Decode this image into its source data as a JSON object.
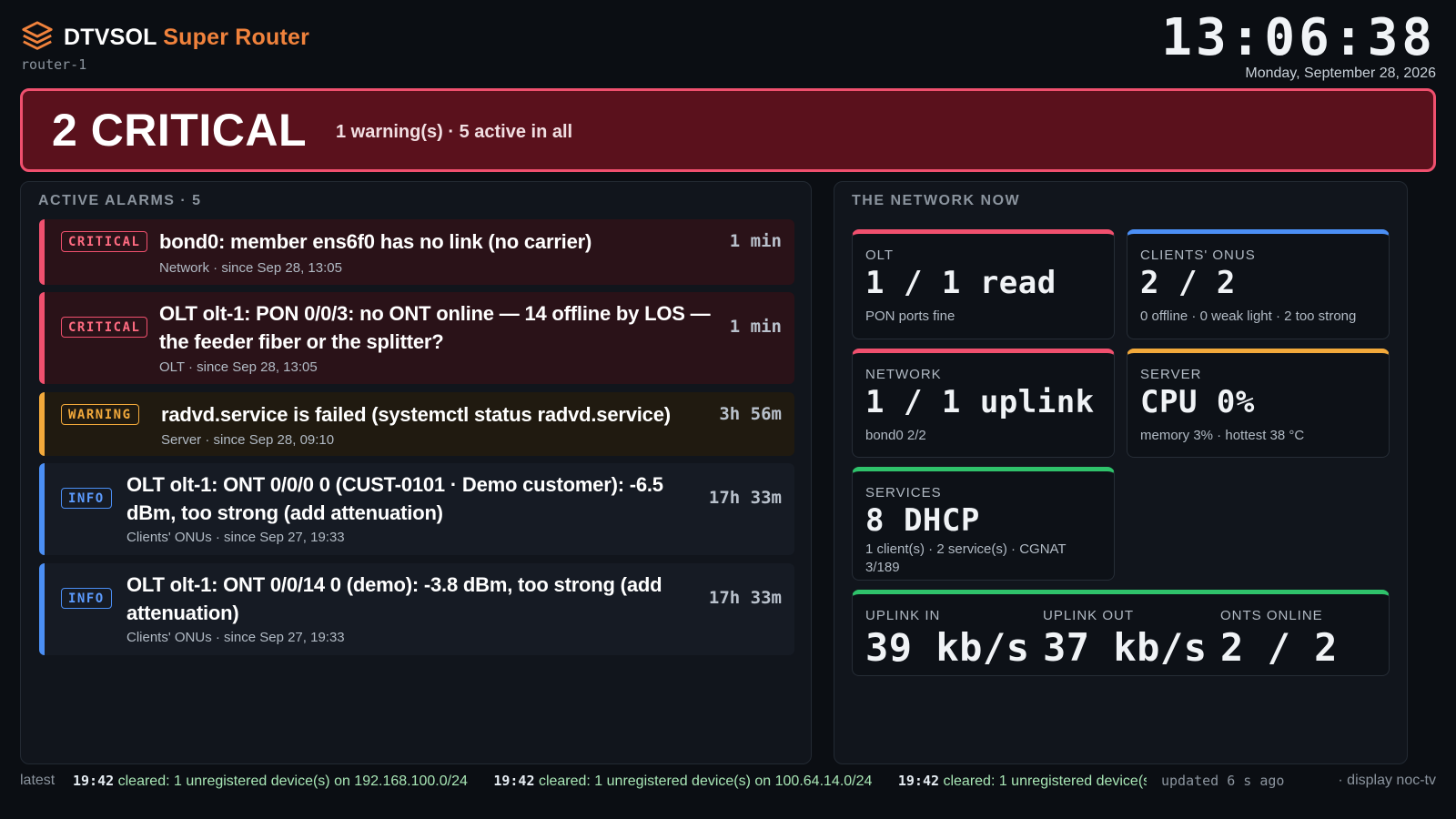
{
  "header": {
    "brand_main": "DTVSOL",
    "brand_accent": "Super Router",
    "hostname": "router-1",
    "clock": "13:06:38",
    "date": "Monday, September 28, 2026",
    "logo_icon": "layers-icon",
    "accent_color": "#f0823c"
  },
  "banner": {
    "headline": "2 CRITICAL",
    "summary": "1 warning(s) · 5 active in all",
    "color": "#f0506e"
  },
  "alarms_panel": {
    "title": "ACTIVE ALARMS · 5",
    "items": [
      {
        "severity": "CRITICAL",
        "title": "bond0: member ens6f0 has no link (no carrier)",
        "meta": "Network · since Sep 28, 13:05",
        "age": "1 min"
      },
      {
        "severity": "CRITICAL",
        "title_line1": "OLT olt-1: PON 0/0/3: no ONT online — 14 offline by LOS —",
        "title_line2": "the feeder fiber or the splitter?",
        "meta": "OLT · since Sep 28, 13:05",
        "age": "1 min"
      },
      {
        "severity": "WARNING",
        "title": "radvd.service is failed (systemctl status radvd.service)",
        "meta": "Server · since Sep 28, 09:10",
        "age": "3h 56m"
      },
      {
        "severity": "INFO",
        "title_line1": "OLT olt-1: ONT 0/0/0 0 (CUST-0101 · Demo customer): -6.5",
        "title_line2": "dBm, too strong (add attenuation)",
        "meta": "Clients' ONUs · since Sep 27, 19:33",
        "age": "17h 33m"
      },
      {
        "severity": "INFO",
        "title_line1": "OLT olt-1: ONT 0/0/14 0 (demo): -3.8 dBm, too strong (add",
        "title_line2": "attenuation)",
        "meta": "Clients' ONUs · since Sep 27, 19:33",
        "age": "17h 33m"
      }
    ]
  },
  "network_panel": {
    "title": "THE NETWORK NOW",
    "cards": {
      "olt": {
        "label": "OLT",
        "value": "1 / 1 read",
        "sub": "PON ports fine",
        "color": "#f0506e"
      },
      "onus": {
        "label": "CLIENTS' ONUS",
        "value": "2 / 2",
        "sub": "0 offline · 0 weak light · 2 too strong",
        "color": "#4b8ff5"
      },
      "network": {
        "label": "NETWORK",
        "value": "1 / 1 uplink",
        "sub": "bond0 2/2",
        "color": "#f0506e"
      },
      "server": {
        "label": "SERVER",
        "value": "CPU 0%",
        "sub": "memory 3% · hottest 38 °C",
        "color": "#f2a93b"
      },
      "services": {
        "label": "SERVICES",
        "value": "8 DHCP",
        "sub_line1": "1 client(s) · 2 service(s) · CGNAT",
        "sub_line2": "3/189",
        "color": "#2fc26b"
      }
    },
    "stats": {
      "color": "#2fc26b",
      "uplink_in_label": "UPLINK IN",
      "uplink_in_value": "39 kb/s",
      "uplink_out_label": "UPLINK OUT",
      "uplink_out_value": "37 kb/s",
      "onts_label": "ONTS ONLINE",
      "onts_value": "2 / 2"
    }
  },
  "footer": {
    "latest_label": "latest",
    "events": [
      {
        "time": "19:42",
        "text": "cleared: 1 unregistered device(s) on 192.168.100.0/24"
      },
      {
        "time": "19:42",
        "text": "cleared: 1 unregistered device(s) on 100.64.14.0/24"
      },
      {
        "time": "19:42",
        "text": "cleared: 1 unregistered device(s"
      }
    ],
    "updated": "updated 6 s ago",
    "display": "· display noc-tv"
  }
}
